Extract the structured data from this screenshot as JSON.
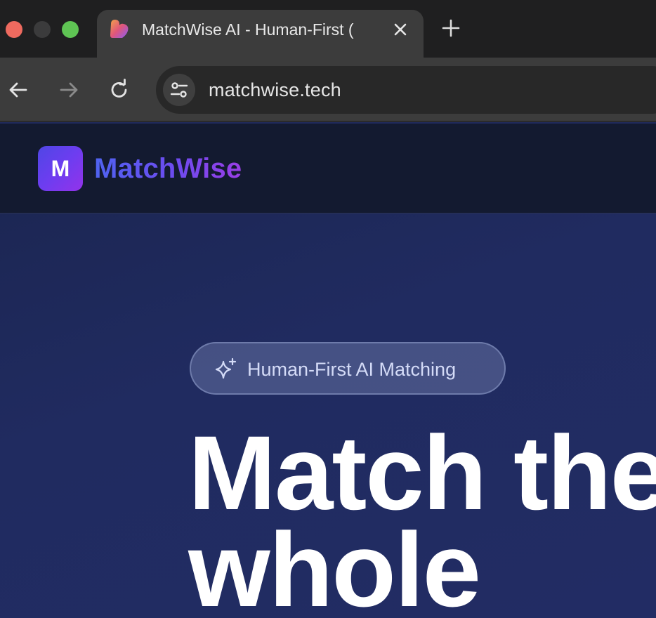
{
  "browser": {
    "tab": {
      "title": "MatchWise AI - Human-First (",
      "favicon": "heart-favicon-icon"
    },
    "new_tab_icon": "plus-icon",
    "nav": {
      "back_icon": "arrow-left-icon",
      "forward_icon": "arrow-right-icon",
      "reload_icon": "reload-icon"
    },
    "address_bar": {
      "url": "matchwise.tech",
      "site_info_icon": "tune-icon"
    }
  },
  "site": {
    "logo_letter": "M",
    "brand_name": "MatchWise"
  },
  "hero": {
    "badge": "Human-First AI Matching",
    "badge_icon": "sparkles-icon",
    "title_line1": "Match the",
    "title_line2": "whole"
  },
  "colors": {
    "brand_gradient_start": "#4f46e5",
    "brand_gradient_end": "#9333ea",
    "header_bg": "#131a30",
    "hero_bg": "#1f2a5c",
    "badge_text": "#d4dbf7"
  }
}
